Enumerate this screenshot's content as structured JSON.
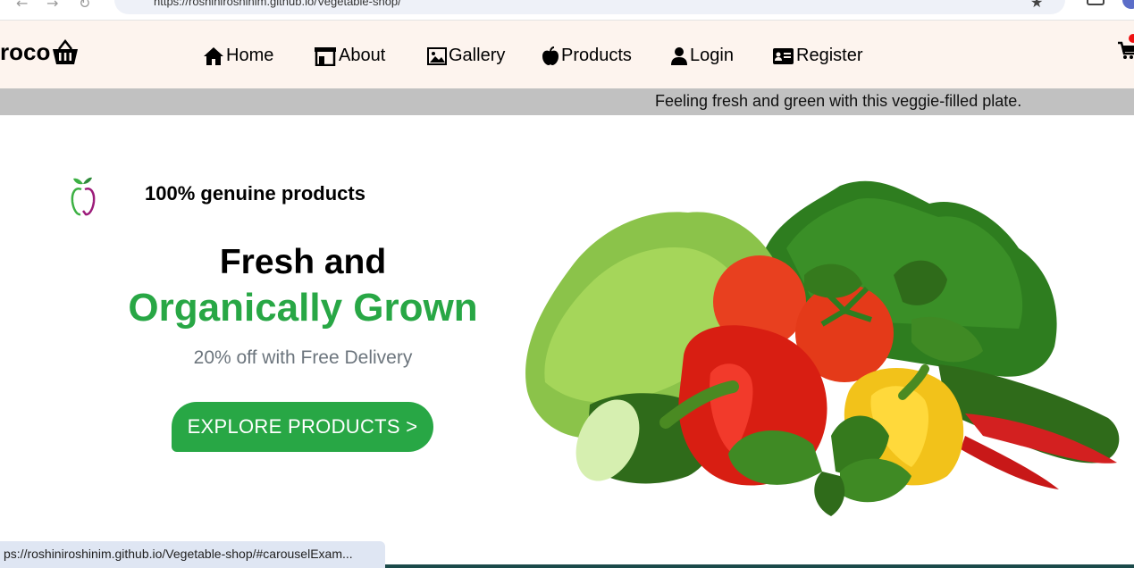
{
  "browser": {
    "url": "https://roshiniroshinim.github.io/Vegetable-shop/",
    "status_url": "ps://roshiniroshinim.github.io/Vegetable-shop/#carouselExam..."
  },
  "navbar": {
    "brand": "roco",
    "items": [
      {
        "label": "Home",
        "icon": "home-icon"
      },
      {
        "label": "About",
        "icon": "store-icon"
      },
      {
        "label": "Gallery",
        "icon": "image-icon"
      },
      {
        "label": "Products",
        "icon": "apple-icon"
      },
      {
        "label": "Login",
        "icon": "user-icon"
      },
      {
        "label": "Register",
        "icon": "id-card-icon"
      }
    ],
    "cart_icon": "cart-icon"
  },
  "marquee": {
    "text": "Feeling fresh and green with this veggie-filled plate."
  },
  "hero": {
    "tagline": "100% genuine products",
    "headline_line1": "Fresh and",
    "headline_line2": "Organically Grown",
    "offer": "20% off with Free Delivery",
    "cta_label": "EXPLORE PRODUCTS >"
  },
  "colors": {
    "accent_green": "#28a745",
    "navbar_bg": "#fdf4ee",
    "marquee_bg": "#c1c1c1",
    "muted_text": "#6c757d"
  }
}
